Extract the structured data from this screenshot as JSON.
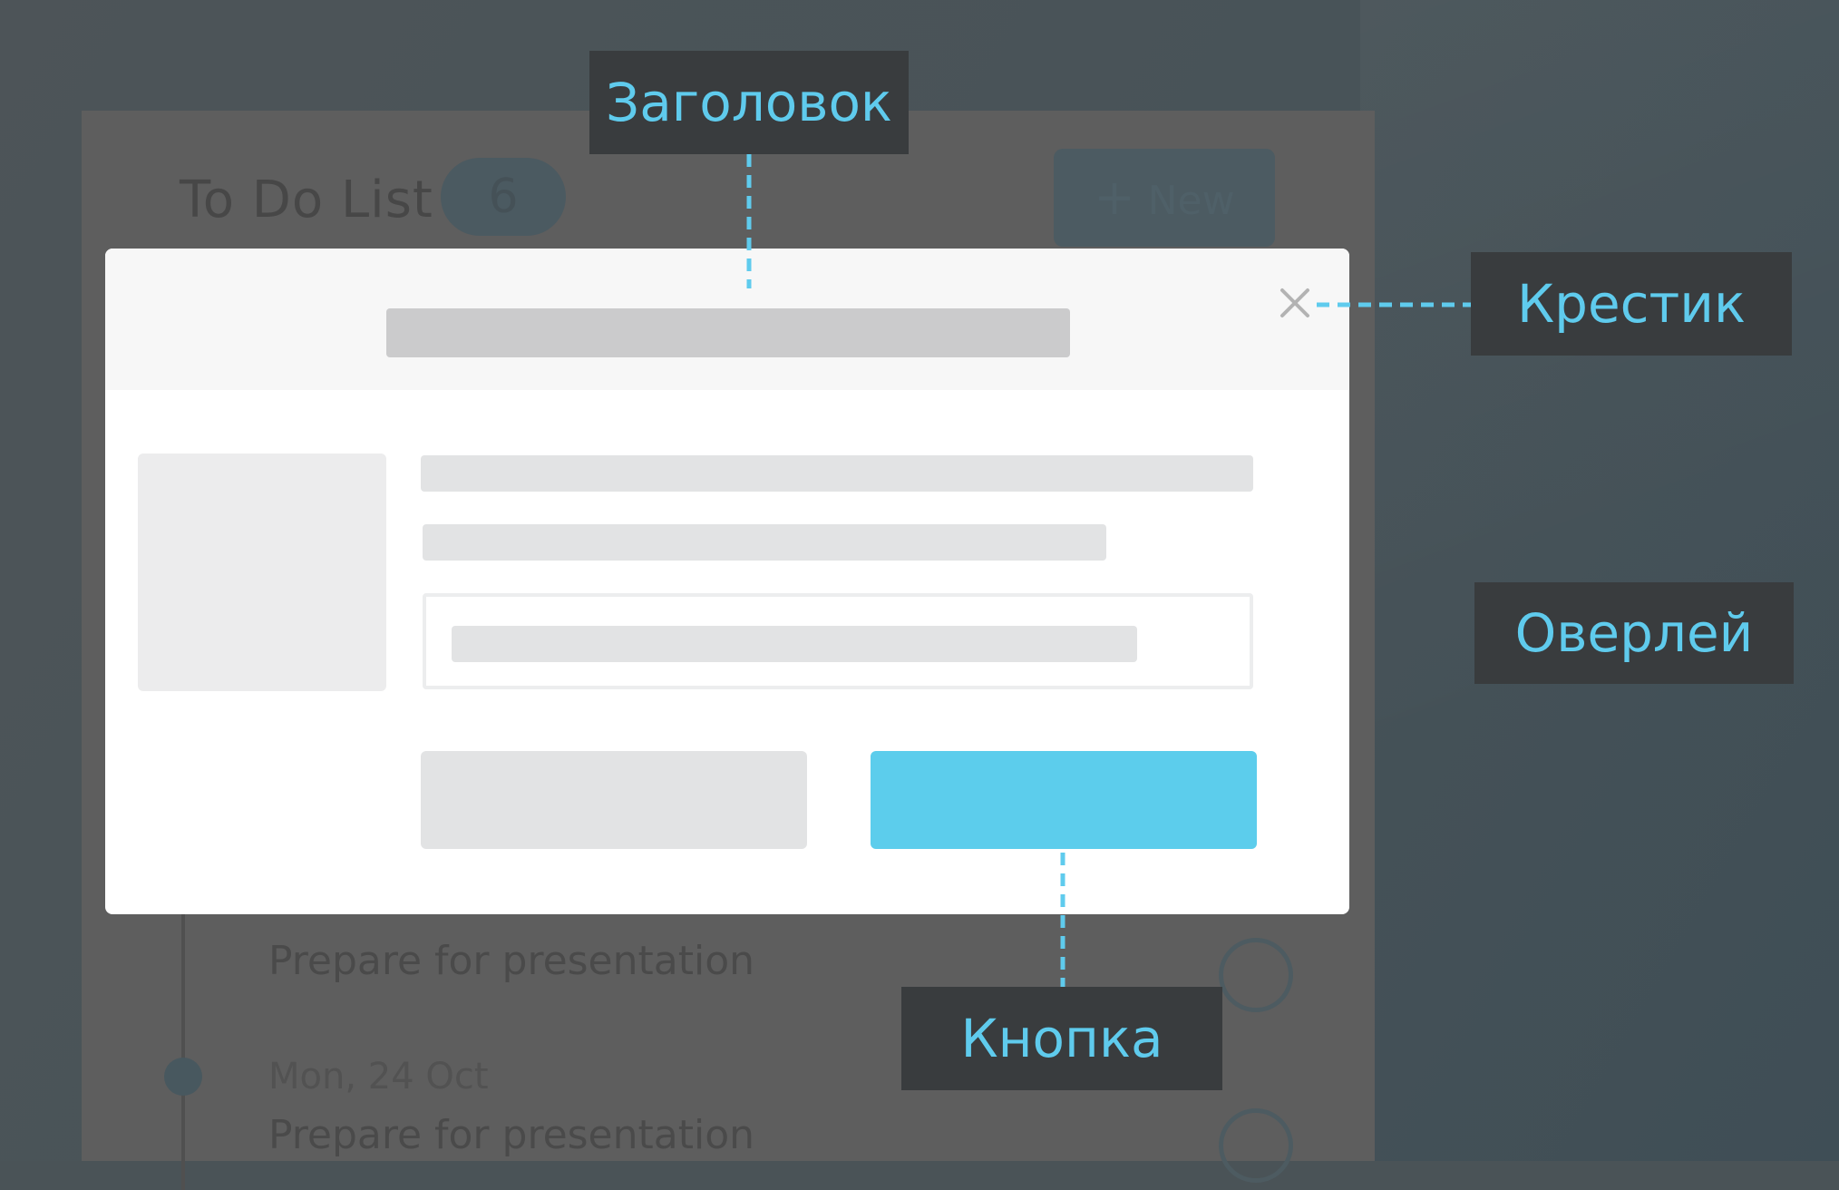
{
  "background_app": {
    "title": "To Do List",
    "count": "6",
    "new_button": {
      "icon": "plus-icon",
      "label": "New"
    },
    "tasks": [
      {
        "title": "Prepare for presentation"
      },
      {
        "date": "Mon, 24 Oct",
        "title": "Prepare for presentation"
      }
    ]
  },
  "modal": {
    "close_icon": "close-icon",
    "primary_button_color": "#5ccdec"
  },
  "callouts": {
    "header": "Заголовок",
    "close": "Крестик",
    "overlay": "Оверлей",
    "button": "Кнопка"
  },
  "colors": {
    "accent": "#5fcbed",
    "callout_bg": "#393c3e",
    "overlay": "#4a5357"
  }
}
